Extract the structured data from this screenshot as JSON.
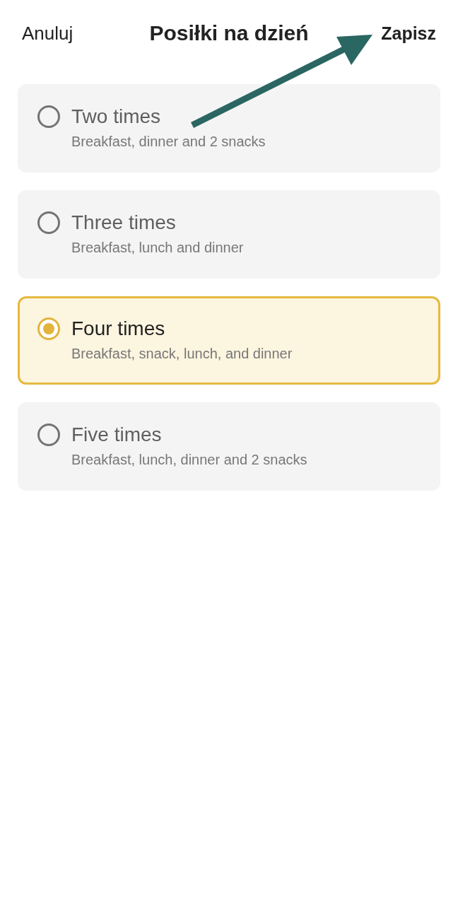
{
  "header": {
    "cancel": "Anuluj",
    "title": "Posiłki na dzień",
    "save": "Zapisz"
  },
  "options": [
    {
      "title": "Two times",
      "description": "Breakfast, dinner and 2 snacks",
      "selected": false
    },
    {
      "title": "Three times",
      "description": "Breakfast, lunch and dinner",
      "selected": false
    },
    {
      "title": "Four times",
      "description": "Breakfast, snack, lunch, and dinner",
      "selected": true
    },
    {
      "title": "Five times",
      "description": "Breakfast, lunch, dinner and 2 snacks",
      "selected": false
    }
  ],
  "annotation": {
    "kind": "arrow"
  }
}
